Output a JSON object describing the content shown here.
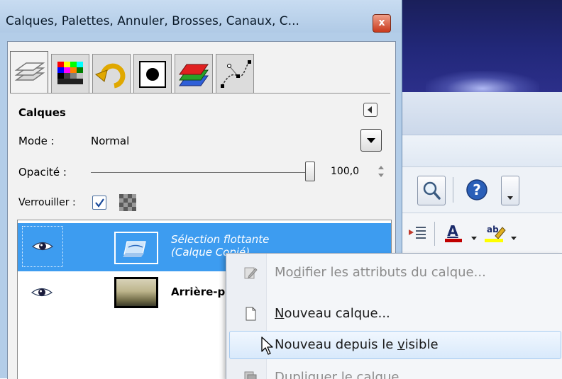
{
  "window": {
    "title": "Calques, Palettes, Annuler, Brosses, Canaux, C...",
    "close_glyph": "x"
  },
  "tabs": [
    {
      "icon": "layers-icon",
      "active": true
    },
    {
      "icon": "palette-icon",
      "active": false
    },
    {
      "icon": "undo-icon",
      "active": false
    },
    {
      "icon": "brush-icon",
      "active": false
    },
    {
      "icon": "channels-icon",
      "active": false
    },
    {
      "icon": "paths-icon",
      "active": false
    }
  ],
  "layers_panel": {
    "heading": "Calques",
    "mode_label": "Mode :",
    "mode_value": "Normal",
    "opacity_label": "Opacité :",
    "opacity_value": "100,0",
    "opacity_fraction": 1.0,
    "lock_label": "Verrouiller :",
    "lock_checked": true
  },
  "layers": [
    {
      "name_line1": "Sélection flottante",
      "name_line2": "(Calque Copié)",
      "visible": true,
      "selected": true
    },
    {
      "name": "Arrière-p",
      "visible": true,
      "selected": false
    }
  ],
  "context_menu": {
    "items": [
      {
        "pre": "Mo",
        "u": "d",
        "post": "ifier les attributs du calque...",
        "enabled": false,
        "icon": "edit-icon"
      },
      {
        "pre": "",
        "u": "N",
        "post": "ouveau calque...",
        "enabled": true,
        "icon": "new-page-icon"
      },
      {
        "pre": "Nouveau depuis le ",
        "u": "v",
        "post": "isible",
        "enabled": true,
        "highlighted": true,
        "icon": ""
      },
      {
        "pre": "D",
        "u": "u",
        "post": "pliquer le calque",
        "enabled": false,
        "icon": "duplicate-icon"
      }
    ]
  },
  "colors": {
    "selection_blue": "#3d9cf0",
    "title_bar": "#b3cde8",
    "menu_highlight": "#d8e9fb"
  }
}
